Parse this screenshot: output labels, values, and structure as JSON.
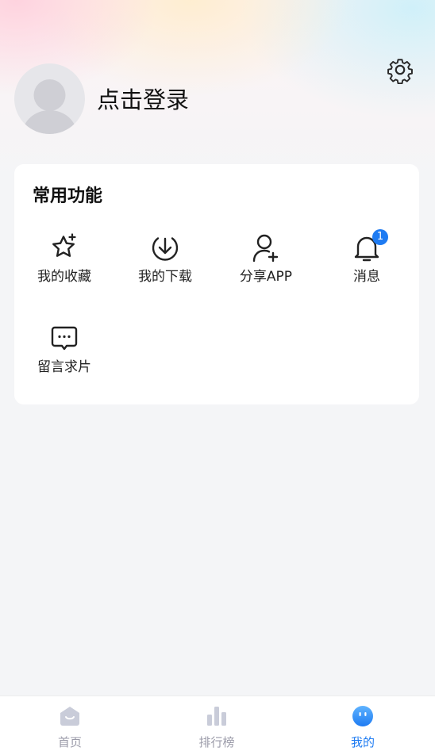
{
  "header": {
    "login_text": "点击登录",
    "settings_icon": "gear-icon",
    "avatar_icon": "default-avatar-icon"
  },
  "functions": {
    "title": "常用功能",
    "items": [
      {
        "label": "我的收藏",
        "icon": "star-sparkle-icon"
      },
      {
        "label": "我的下载",
        "icon": "download-circle-icon"
      },
      {
        "label": "分享APP",
        "icon": "user-add-icon"
      },
      {
        "label": "消息",
        "icon": "bell-icon",
        "badge": "1"
      },
      {
        "label": "留言求片",
        "icon": "message-dots-icon"
      }
    ]
  },
  "tabbar": {
    "items": [
      {
        "label": "首页",
        "icon": "home-icon",
        "active": false
      },
      {
        "label": "排行榜",
        "icon": "bar-chart-icon",
        "active": false
      },
      {
        "label": "我的",
        "icon": "smiley-face-icon",
        "active": true
      }
    ]
  },
  "colors": {
    "accent": "#1e7bf2",
    "inactive_tab": "#9a9aa8",
    "background": "#f4f5f7"
  }
}
